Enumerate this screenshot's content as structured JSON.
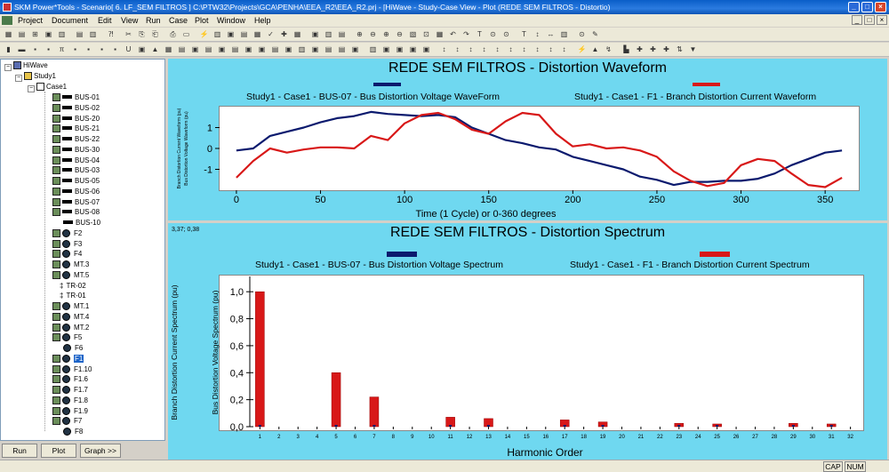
{
  "window": {
    "title": "SKM Power*Tools - Scenario[ 6. LF_SEM FILTROS ] C:\\PTW32\\Projects\\GCA\\PENHA\\EEA_R2\\EEA_R2.prj - [HiWave - Study-Case View - Plot (REDE SEM FILTROS - Distortio)"
  },
  "menu": [
    "Project",
    "Document",
    "Edit",
    "View",
    "Run",
    "Case",
    "Plot",
    "Window",
    "Help"
  ],
  "tree": {
    "root": "HiWave",
    "study": "Study1",
    "case": "Case1",
    "items": [
      "BUS-01",
      "BUS-02",
      "BUS-20",
      "BUS-21",
      "BUS-22",
      "BUS-30",
      "BUS-04",
      "BUS-03",
      "BUS-05",
      "BUS-06",
      "BUS-07",
      "BUS-08",
      "BUS-10",
      "F2",
      "F3",
      "F4",
      "MT.3",
      "MT.5",
      "TR-02",
      "TR-01",
      "MT.1",
      "MT.4",
      "MT.2",
      "F5",
      "F6",
      "F1",
      "F1.10",
      "F1.6",
      "F1.7",
      "F1.8",
      "F1.9",
      "F7",
      "F8"
    ],
    "selected": "F1"
  },
  "buttons": {
    "run": "Run",
    "plot": "Plot",
    "graph": "Graph >>"
  },
  "status": {
    "cap": "CAP",
    "num": "NUM"
  },
  "colors": {
    "voltage": "#0b1a6e",
    "current": "#d81818"
  },
  "waveform": {
    "title": "REDE SEM FILTROS - Distortion Waveform",
    "legend_voltage": "Study1 - Case1 - BUS-07 - Bus Distortion Voltage WaveForm",
    "legend_current": "Study1 - Case1 - F1 - Branch Distortion Current Waveform",
    "xlabel": "Time (1 Cycle) or 0-360 degrees",
    "ylabel_left": "Branch Distortion Current Waveform (pu)",
    "ylabel_right": "Bus Distortion Voltage Waveform (pu)"
  },
  "spectrum": {
    "title": "REDE SEM FILTROS - Distortion Spectrum",
    "legend_voltage": "Study1 - Case1 - BUS-07 - Bus Distortion Voltage Spectrum",
    "legend_current": "Study1 - Case1 - F1 - Branch Distortion Current Spectrum",
    "xlabel": "Harmonic Order",
    "ylabel_left": "Branch Distortion Current Spectrum (pu)",
    "ylabel_right": "Bus Distortion Voltage Spectrum (pu)",
    "coord": "3,37; 0,38"
  },
  "chart_data": [
    {
      "type": "line",
      "title": "REDE SEM FILTROS - Distortion Waveform",
      "xlabel": "Time (1 Cycle) or 0-360 degrees",
      "xlim": [
        -10,
        370
      ],
      "ylim": [
        -2,
        2
      ],
      "x_ticks": [
        0,
        50,
        100,
        150,
        200,
        250,
        300,
        350
      ],
      "y_ticks": [
        -1,
        0,
        1
      ],
      "y_tick_labels": [
        "-1",
        "0",
        "1"
      ],
      "series": [
        {
          "name": "Study1 - Case1 - BUS-07 - Bus Distortion Voltage WaveForm",
          "color": "#0b1a6e",
          "x": [
            0,
            10,
            20,
            30,
            40,
            50,
            60,
            70,
            80,
            90,
            100,
            110,
            120,
            130,
            140,
            150,
            160,
            170,
            180,
            190,
            200,
            210,
            220,
            230,
            240,
            250,
            260,
            270,
            280,
            290,
            300,
            310,
            320,
            330,
            340,
            350,
            360
          ],
          "y": [
            -0.1,
            0.0,
            0.6,
            0.8,
            1.0,
            1.25,
            1.45,
            1.55,
            1.75,
            1.65,
            1.6,
            1.55,
            1.6,
            1.5,
            1.0,
            0.7,
            0.4,
            0.25,
            0.05,
            -0.05,
            -0.4,
            -0.6,
            -0.8,
            -1.0,
            -1.35,
            -1.5,
            -1.75,
            -1.6,
            -1.6,
            -1.55,
            -1.55,
            -1.45,
            -1.2,
            -0.8,
            -0.5,
            -0.2,
            -0.1
          ]
        },
        {
          "name": "Study1 - Case1 - F1 - Branch Distortion Current Waveform",
          "color": "#d81818",
          "x": [
            0,
            10,
            20,
            30,
            40,
            50,
            60,
            70,
            80,
            90,
            100,
            110,
            120,
            130,
            140,
            150,
            160,
            170,
            180,
            190,
            200,
            210,
            220,
            230,
            240,
            250,
            260,
            270,
            280,
            290,
            300,
            310,
            320,
            330,
            340,
            350,
            360
          ],
          "y": [
            -1.4,
            -0.6,
            0.0,
            -0.2,
            -0.05,
            0.05,
            0.05,
            0.0,
            0.6,
            0.4,
            1.2,
            1.6,
            1.7,
            1.4,
            0.9,
            0.7,
            1.3,
            1.7,
            1.6,
            0.7,
            0.1,
            0.2,
            0.0,
            0.05,
            -0.1,
            -0.4,
            -1.1,
            -1.55,
            -1.8,
            -1.65,
            -0.8,
            -0.5,
            -0.6,
            -1.2,
            -1.75,
            -1.85,
            -1.4
          ]
        }
      ]
    },
    {
      "type": "bar",
      "title": "REDE SEM FILTROS - Distortion Spectrum",
      "xlabel": "Harmonic Order",
      "ylim": [
        0,
        1.1
      ],
      "categories": [
        1,
        2,
        3,
        4,
        5,
        6,
        7,
        8,
        9,
        10,
        11,
        12,
        13,
        14,
        15,
        16,
        17,
        18,
        19,
        20,
        21,
        22,
        23,
        24,
        25,
        26,
        27,
        28,
        29,
        30,
        31,
        32
      ],
      "y_tick_labels": [
        "0,0",
        "0,2",
        "0,4",
        "0,6",
        "0,8",
        "1,0"
      ],
      "series": [
        {
          "name": "Study1 - Case1 - F1 - Branch Distortion Current Spectrum",
          "color": "#d81818",
          "values": [
            1.0,
            0,
            0,
            0,
            0.4,
            0,
            0.22,
            0,
            0,
            0,
            0.07,
            0,
            0.06,
            0,
            0,
            0,
            0.05,
            0,
            0.035,
            0,
            0,
            0,
            0.025,
            0,
            0.02,
            0,
            0,
            0,
            0.025,
            0,
            0.02,
            0
          ]
        },
        {
          "name": "Study1 - Case1 - BUS-07 - Bus Distortion Voltage Spectrum",
          "color": "#0b1a6e",
          "values": [
            0.01,
            0,
            0,
            0,
            0.008,
            0,
            0.006,
            0,
            0,
            0,
            0.003,
            0,
            0.003,
            0,
            0,
            0,
            0.002,
            0,
            0.002,
            0,
            0,
            0,
            0.001,
            0,
            0.001,
            0,
            0,
            0,
            0.001,
            0,
            0.001,
            0
          ]
        }
      ]
    }
  ]
}
